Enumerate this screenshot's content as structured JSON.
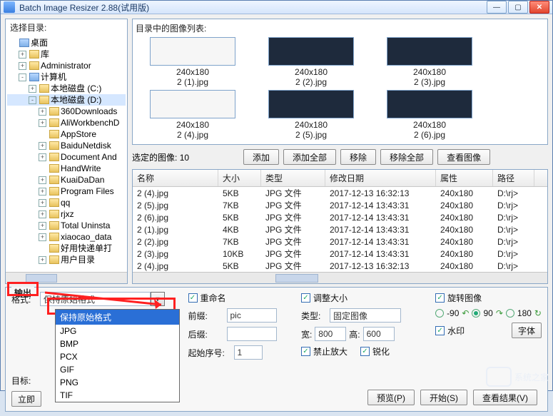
{
  "window": {
    "title": "Batch Image Resizer 2.88(试用版)"
  },
  "winbtns": {
    "min": "—",
    "max": "▢",
    "close": "✕"
  },
  "left": {
    "header": "选择目录:",
    "nodes": [
      {
        "depth": 0,
        "box": "",
        "icon": "blue",
        "label": "桌面"
      },
      {
        "depth": 1,
        "box": "+",
        "icon": "",
        "label": "库"
      },
      {
        "depth": 1,
        "box": "+",
        "icon": "",
        "label": "Administrator"
      },
      {
        "depth": 1,
        "box": "-",
        "icon": "blue",
        "label": "计算机"
      },
      {
        "depth": 2,
        "box": "+",
        "icon": "",
        "label": "本地磁盘 (C:)"
      },
      {
        "depth": 2,
        "box": "-",
        "icon": "",
        "label": "本地磁盘 (D:)",
        "sel": true
      },
      {
        "depth": 3,
        "box": "+",
        "icon": "",
        "label": "360Downloads"
      },
      {
        "depth": 3,
        "box": "+",
        "icon": "",
        "label": "AliWorkbenchD"
      },
      {
        "depth": 3,
        "box": "",
        "icon": "",
        "label": "AppStore"
      },
      {
        "depth": 3,
        "box": "+",
        "icon": "",
        "label": "BaiduNetdisk"
      },
      {
        "depth": 3,
        "box": "+",
        "icon": "",
        "label": "Document And"
      },
      {
        "depth": 3,
        "box": "",
        "icon": "",
        "label": "HandWrite"
      },
      {
        "depth": 3,
        "box": "+",
        "icon": "",
        "label": "KuaiDaDan"
      },
      {
        "depth": 3,
        "box": "+",
        "icon": "",
        "label": "Program Files"
      },
      {
        "depth": 3,
        "box": "+",
        "icon": "",
        "label": "qq"
      },
      {
        "depth": 3,
        "box": "+",
        "icon": "",
        "label": "rjxz"
      },
      {
        "depth": 3,
        "box": "+",
        "icon": "",
        "label": "Total Uninsta"
      },
      {
        "depth": 3,
        "box": "+",
        "icon": "",
        "label": "xiaocao_data"
      },
      {
        "depth": 3,
        "box": "",
        "icon": "",
        "label": "好用快递单打"
      },
      {
        "depth": 3,
        "box": "+",
        "icon": "",
        "label": "用户目录"
      }
    ]
  },
  "thumbs": {
    "header": "目录中的图像列表:",
    "row1": [
      {
        "dim": "240x180",
        "name": "2 (1).jpg",
        "cls": "win"
      },
      {
        "dim": "240x180",
        "name": "2 (2).jpg",
        "cls": "dark"
      },
      {
        "dim": "240x180",
        "name": "2 (3).jpg",
        "cls": "dark"
      }
    ],
    "row2": [
      {
        "dim": "240x180",
        "name": "2 (4).jpg",
        "cls": "win"
      },
      {
        "dim": "240x180",
        "name": "2 (5).jpg",
        "cls": "dark"
      },
      {
        "dim": "240x180",
        "name": "2 (6).jpg",
        "cls": "dark"
      }
    ]
  },
  "selrow": {
    "label": "选定的图像:",
    "count": "10",
    "add": "添加",
    "addall": "添加全部",
    "remove": "移除",
    "removeall": "移除全部",
    "view": "查看图像"
  },
  "table": {
    "headers": [
      "名称",
      "大小",
      "类型",
      "修改日期",
      "属性",
      "路径"
    ],
    "rows": [
      [
        "2 (4).jpg",
        "5KB",
        "JPG 文件",
        "2017-12-13 16:32:13",
        "240x180",
        "D:\\rj>"
      ],
      [
        "2 (5).jpg",
        "7KB",
        "JPG 文件",
        "2017-12-14 13:43:31",
        "240x180",
        "D:\\rj>"
      ],
      [
        "2 (6).jpg",
        "5KB",
        "JPG 文件",
        "2017-12-14 13:43:31",
        "240x180",
        "D:\\rj>"
      ],
      [
        "2 (1).jpg",
        "4KB",
        "JPG 文件",
        "2017-12-14 13:43:31",
        "240x180",
        "D:\\rj>"
      ],
      [
        "2 (2).jpg",
        "7KB",
        "JPG 文件",
        "2017-12-14 13:43:31",
        "240x180",
        "D:\\rj>"
      ],
      [
        "2 (3).jpg",
        "10KB",
        "JPG 文件",
        "2017-12-14 13:43:31",
        "240x180",
        "D:\\rj>"
      ],
      [
        "2 (4).jpg",
        "5KB",
        "JPG 文件",
        "2017-12-13 16:32:13",
        "240x180",
        "D:\\rj>"
      ]
    ]
  },
  "output": {
    "group": "输出",
    "format_label": "格式:",
    "format_value": "保持原始格式",
    "target_label": "目标:",
    "now_btn": "立即",
    "dropdown": [
      "保持原始格式",
      "JPG",
      "BMP",
      "PCX",
      "GIF",
      "PNG",
      "TIF"
    ]
  },
  "rename": {
    "chk": "重命名",
    "prefix_label": "前缀:",
    "prefix_value": "pic",
    "suffix_label": "后缀:",
    "suffix_value": "",
    "start_label": "起始序号:",
    "start_value": "1"
  },
  "size": {
    "chk": "调整大小",
    "type_label": "类型:",
    "type_value": "固定图像",
    "w_label": "宽:",
    "w_value": "800",
    "h_label": "高:",
    "h_value": "600",
    "noscale": "禁止放大",
    "sharpen": "锐化"
  },
  "rotate": {
    "chk": "旋转图像",
    "neg90": "-90",
    "pos90": "90",
    "r180": "180",
    "watermark": "水印",
    "font": "字体"
  },
  "bottom": {
    "preview": "预览(P)",
    "start": "开始(S)",
    "result": "查看结果(V)"
  },
  "brand": "系统之家"
}
